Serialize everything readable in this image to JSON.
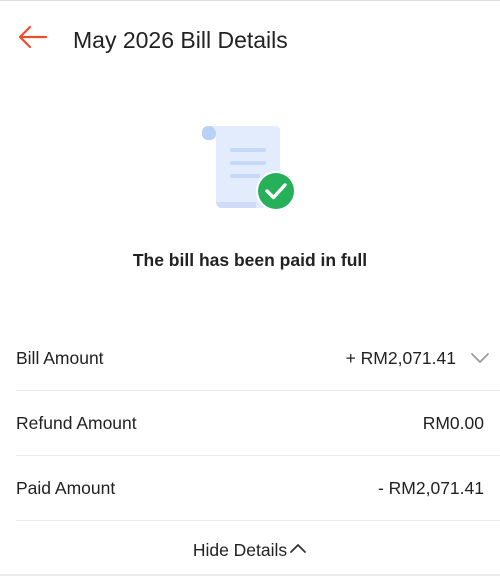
{
  "header": {
    "title": "May 2026 Bill Details",
    "back_icon": "arrow-left-icon",
    "accent_color": "#ee4d2d"
  },
  "status": {
    "icon": "bill-paid-check-icon",
    "message": "The bill has been paid in full",
    "check_color": "#27b05a"
  },
  "details": {
    "rows": [
      {
        "label": "Bill Amount",
        "value": "+ RM2,071.41",
        "expand_icon": "chevron-down-icon"
      },
      {
        "label": "Refund Amount",
        "value": "RM0.00"
      },
      {
        "label": "Paid Amount",
        "value": "- RM2,071.41"
      }
    ],
    "toggle_label": "Hide Details",
    "toggle_icon": "chevron-up-icon"
  }
}
